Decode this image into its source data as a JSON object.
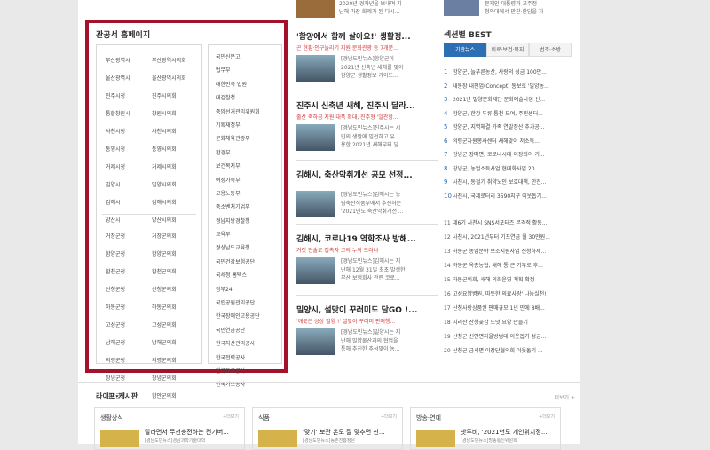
{
  "gov": {
    "title": "관공서 홈페이지",
    "local_group1": [
      "부산광역시",
      "부산광역시의회",
      "울산광역시",
      "울산광역시의회",
      "진주시청",
      "진주시의회",
      "통합창원시",
      "창원시의회",
      "사천시청",
      "사천시의회",
      "통영시청",
      "통영시의회",
      "거제시청",
      "거제시의회",
      "밀양시",
      "밀양시의회",
      "김해시",
      "김해시의회",
      "양산시",
      "양산시의회"
    ],
    "local_group2": [
      "거창군청",
      "거창군의회",
      "함양군청",
      "함양군의회",
      "합천군청",
      "합천군의회",
      "산청군청",
      "산청군의회",
      "하동군청",
      "하동군의회",
      "고성군청",
      "고성군의회",
      "남해군청",
      "남해군의회",
      "의령군청",
      "의령군의회",
      "창녕군청",
      "창녕군의회",
      "함안군청",
      "함안군의회"
    ],
    "national": [
      "국민신문고",
      "법무부",
      "대한민국 법원",
      "대검찰청",
      "중앙선거관리위원회",
      "기획재정부",
      "문화체육관광부",
      "환경부",
      "보건복지부",
      "여성가족부",
      "고용노동부",
      "중소벤처기업부",
      "경남지방경찰청",
      "교육부",
      "경상남도교육청",
      "국민건강보험공단",
      "국세청 홈택스",
      "정부24",
      "국립공원관리공단",
      "한국장애인고용공단",
      "국민연금공단",
      "한국자산관리공사",
      "한국전력공사",
      "한국토로공사",
      "한국가스공사"
    ]
  },
  "top": {
    "right_text": [
      "2020년 경자년을 보내며 지",
      "난해 가장 화제가 된 다시..."
    ],
    "far_right": [
      "문재인 대통령과 교주정",
      "청와대에서 만찬·환담을 자"
    ]
  },
  "news": [
    {
      "headline": "'함양에서 함께 살아요!' 생활정...",
      "red": "곤 현황·인구늘리기 지원·문화관광 등 7개분...",
      "text": [
        "[경남도민뉴스]함양군이",
        "2021년 신축년 새해를 맞아",
        "함양군 생활정보 가이드..."
      ]
    },
    {
      "headline": "진주시 신축년 새해, 진주시 달라...",
      "red": "출산 축하금 지원 대폭 확대, 진주형 '일관함...",
      "text": [
        "[경남도민뉴스]진주시는 시",
        "민의 생활에 밀접하고 유",
        "용한 2021년 새해부터 달..."
      ]
    },
    {
      "headline": "김해시, 축산악취개선 공모 선정...",
      "red": "",
      "text": [
        "[경남도민뉴스]김해시는 농",
        "림축산식품부에서 추진하는",
        "'2021년도 축산악취개선 ..."
      ]
    },
    {
      "headline": "김해시, 코로나19 역학조사 방해...",
      "red": "거짓 진술로 접촉자 고의 누락 드러나",
      "text": [
        "[경남도민뉴스]김해시는 지",
        "난해 12월 31일 최초 발생한",
        "부산 보험회사 관련 코로..."
      ]
    },
    {
      "headline": "밀양시, 설맞이 꾸러미도 담GO !...",
      "red": "'깨끗은 상상 밀양 !' 설맞이 꾸러미 판매행...",
      "text": [
        "[경남도민뉴스]밀양시는 지",
        "난해 밀양물산과의 협업을",
        "통해 추진한 추석맞이 농..."
      ]
    }
  ],
  "best": {
    "title": "섹션별 BEST",
    "tabs": [
      "기관뉴스",
      "의료·보건·복지",
      "법조·소방"
    ],
    "top": [
      {
        "n": "1",
        "t": "함양군, 늘푸른농산, 사랑의 성금 100만..."
      },
      {
        "n": "2",
        "t": "내동장 내천업(Concept) 통보로 '밀양농..."
      },
      {
        "n": "3",
        "t": "2021년 밀양문화재단 문화예술사업 신..."
      },
      {
        "n": "4",
        "t": "함양군, 한강 두류 통천 모여, 주민센터..."
      },
      {
        "n": "5",
        "t": "함양군, 지역체결 가족 연말정산 추가공..."
      },
      {
        "n": "6",
        "t": "의령군자원봉사센터 새해맞이 저소득..."
      },
      {
        "n": "7",
        "t": "창녕군 장마면, 코로나시대 이장회의 기..."
      },
      {
        "n": "8",
        "t": "창녕군, 농업소득사업 현대화사업 20..."
      },
      {
        "n": "9",
        "t": "사천시, 동절기 취약노인 보호대책, 안전..."
      },
      {
        "n": "10",
        "t": "사천시, 국제로터리 3590지구 이웃돕기..."
      }
    ],
    "more": [
      {
        "n": "11",
        "t": "제6기 사천시 SNS서포터즈 본격적 활동..."
      },
      {
        "n": "12",
        "t": "사천시, 2021년부터 기프연금 월 30만원..."
      },
      {
        "n": "13",
        "t": "하동군 농업분야 보조지원사업 신청하세..."
      },
      {
        "n": "14",
        "t": "하동군 옥종농협, 새해 통 큰 기부로 후..."
      },
      {
        "n": "15",
        "t": "하동군의회, 새해 의회운영 계획 확정"
      },
      {
        "n": "16",
        "t": "고성요양병원, 따뜻한 의료사랑' 나눔실천!"
      },
      {
        "n": "17",
        "t": "산청사랑상품권 판매규모 1년 만에 8배..."
      },
      {
        "n": "18",
        "t": "지리산 산청곶감 도넛 요양 만들기"
      },
      {
        "n": "19",
        "t": "산청군 신안면자율방범대 이웃돕기 성금..."
      },
      {
        "n": "20",
        "t": "산청군 금서면 이장단협의회 이웃돕기 ..."
      }
    ]
  },
  "life": {
    "title": "라이프·게시판",
    "more": "더보기 +",
    "cards": [
      {
        "title": "생활상식",
        "more": "+더보기",
        "head": "달라면서 무선충전하는 전기버...",
        "sub": "[경남도민뉴스]경남과학기술대학"
      },
      {
        "title": "식품",
        "more": "+더보기",
        "head": "'맞기' 보관 온도 잘 맞추면 신...",
        "sub": "[경남도민뉴스]농촌진흥청은"
      },
      {
        "title": "방송·연예",
        "more": "+더보기",
        "head": "밧투비, '2021년도 개인위치정...",
        "sub": "[경남도민뉴스]방송통신위원회"
      }
    ]
  }
}
